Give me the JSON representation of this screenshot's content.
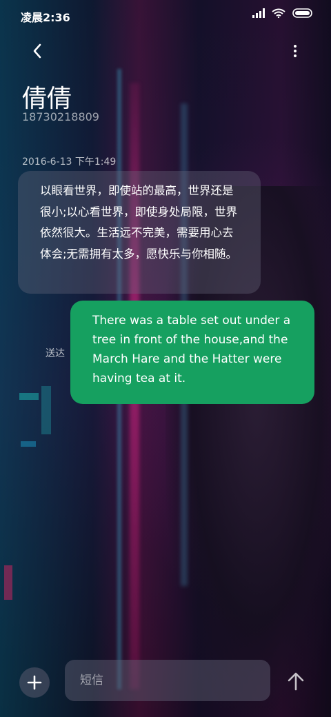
{
  "status": {
    "time": "凌晨2:36"
  },
  "contact": {
    "name": "倩倩",
    "phone": "18730218809"
  },
  "conversation": {
    "timestamp": "2016-6-13 下午1:49",
    "messages": [
      {
        "direction": "incoming",
        "text": "以眼看世界，即使站的最高，世界还是很小;以心看世界，即使身处局限，世界依然很大。生活远不完美，需要用心去体会;无需拥有太多，愿快乐与你相随。"
      },
      {
        "direction": "outgoing",
        "text": "There was a table set out under a tree in front of the house,and the March Hare and the Hatter were having tea at it.",
        "status": "送达"
      }
    ]
  },
  "composer": {
    "placeholder": "短信"
  },
  "icons": {
    "back": "chevron-left-icon",
    "more": "more-vertical-icon",
    "add": "plus-icon",
    "send": "arrow-up-icon"
  },
  "colors": {
    "outgoing_bubble": "#16a060",
    "incoming_bubble": "rgba(110,110,130,0.35)"
  }
}
